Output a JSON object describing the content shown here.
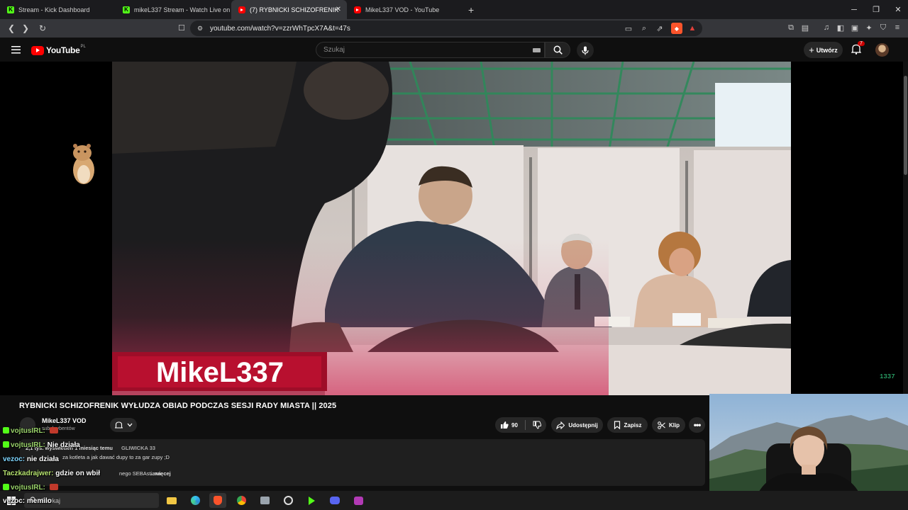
{
  "browser": {
    "tabs": [
      {
        "label": "Stream - Kick Dashboard",
        "favicon": "kick-icon"
      },
      {
        "label": "mikeL337 Stream - Watch Live on",
        "favicon": "kick-icon"
      },
      {
        "label": "(7) RYBNICKI SCHIZOFRENIK",
        "favicon": "youtube-icon",
        "active": true
      },
      {
        "label": "MikeL337 VOD - YouTube",
        "favicon": "youtube-icon"
      }
    ],
    "url": "youtube.com/watch?v=zzrWhTpcX7A&t=47s"
  },
  "youtube": {
    "logo_text": "YouTube",
    "logo_region": "PL",
    "search_placeholder": "Szukaj",
    "create_label": "Utwórz",
    "notification_count": "7"
  },
  "video": {
    "overlay_name": "MikeL337",
    "counter": "1337",
    "title": "RYBNICKI SCHIZOFRENIK WYŁUDZA OBIAD PODCZAS SESJI RADY MIASTA || 2025",
    "channel_name": "MikeL337 VOD",
    "channel_subs": "subskrybentów",
    "likes": "90",
    "share_label": "Udostępnij",
    "save_label": "Zapisz",
    "clip_label": "Klip",
    "desc_meta_a": "2,1 tys. wyświetleń  1 miesiąc temu",
    "desc_meta_b": "GLIWICKA 33",
    "desc_line2": "za kotleta a jak dawać dupy to za gar zupy ;D",
    "desc_line3": "nego SEBAstiana",
    "desc_more": "...więcej"
  },
  "chat": [
    {
      "user": "vojtusIRL:",
      "msg": "",
      "badge": true
    },
    {
      "user": "vojtusIRL:",
      "msg": "Nie działa",
      "badge": true
    },
    {
      "user": "vezoc:",
      "msg": "nie działa",
      "badge": false
    },
    {
      "user": "Taczkadrajwer:",
      "msg": "gdzie on wbił",
      "badge": false
    },
    {
      "user": "vojtusIRL:",
      "msg": "",
      "badge": true
    },
    {
      "user": "vezoc:",
      "msg": "memilo",
      "badge": false
    }
  ],
  "taskbar": {
    "search_placeholder": "Szukaj"
  }
}
